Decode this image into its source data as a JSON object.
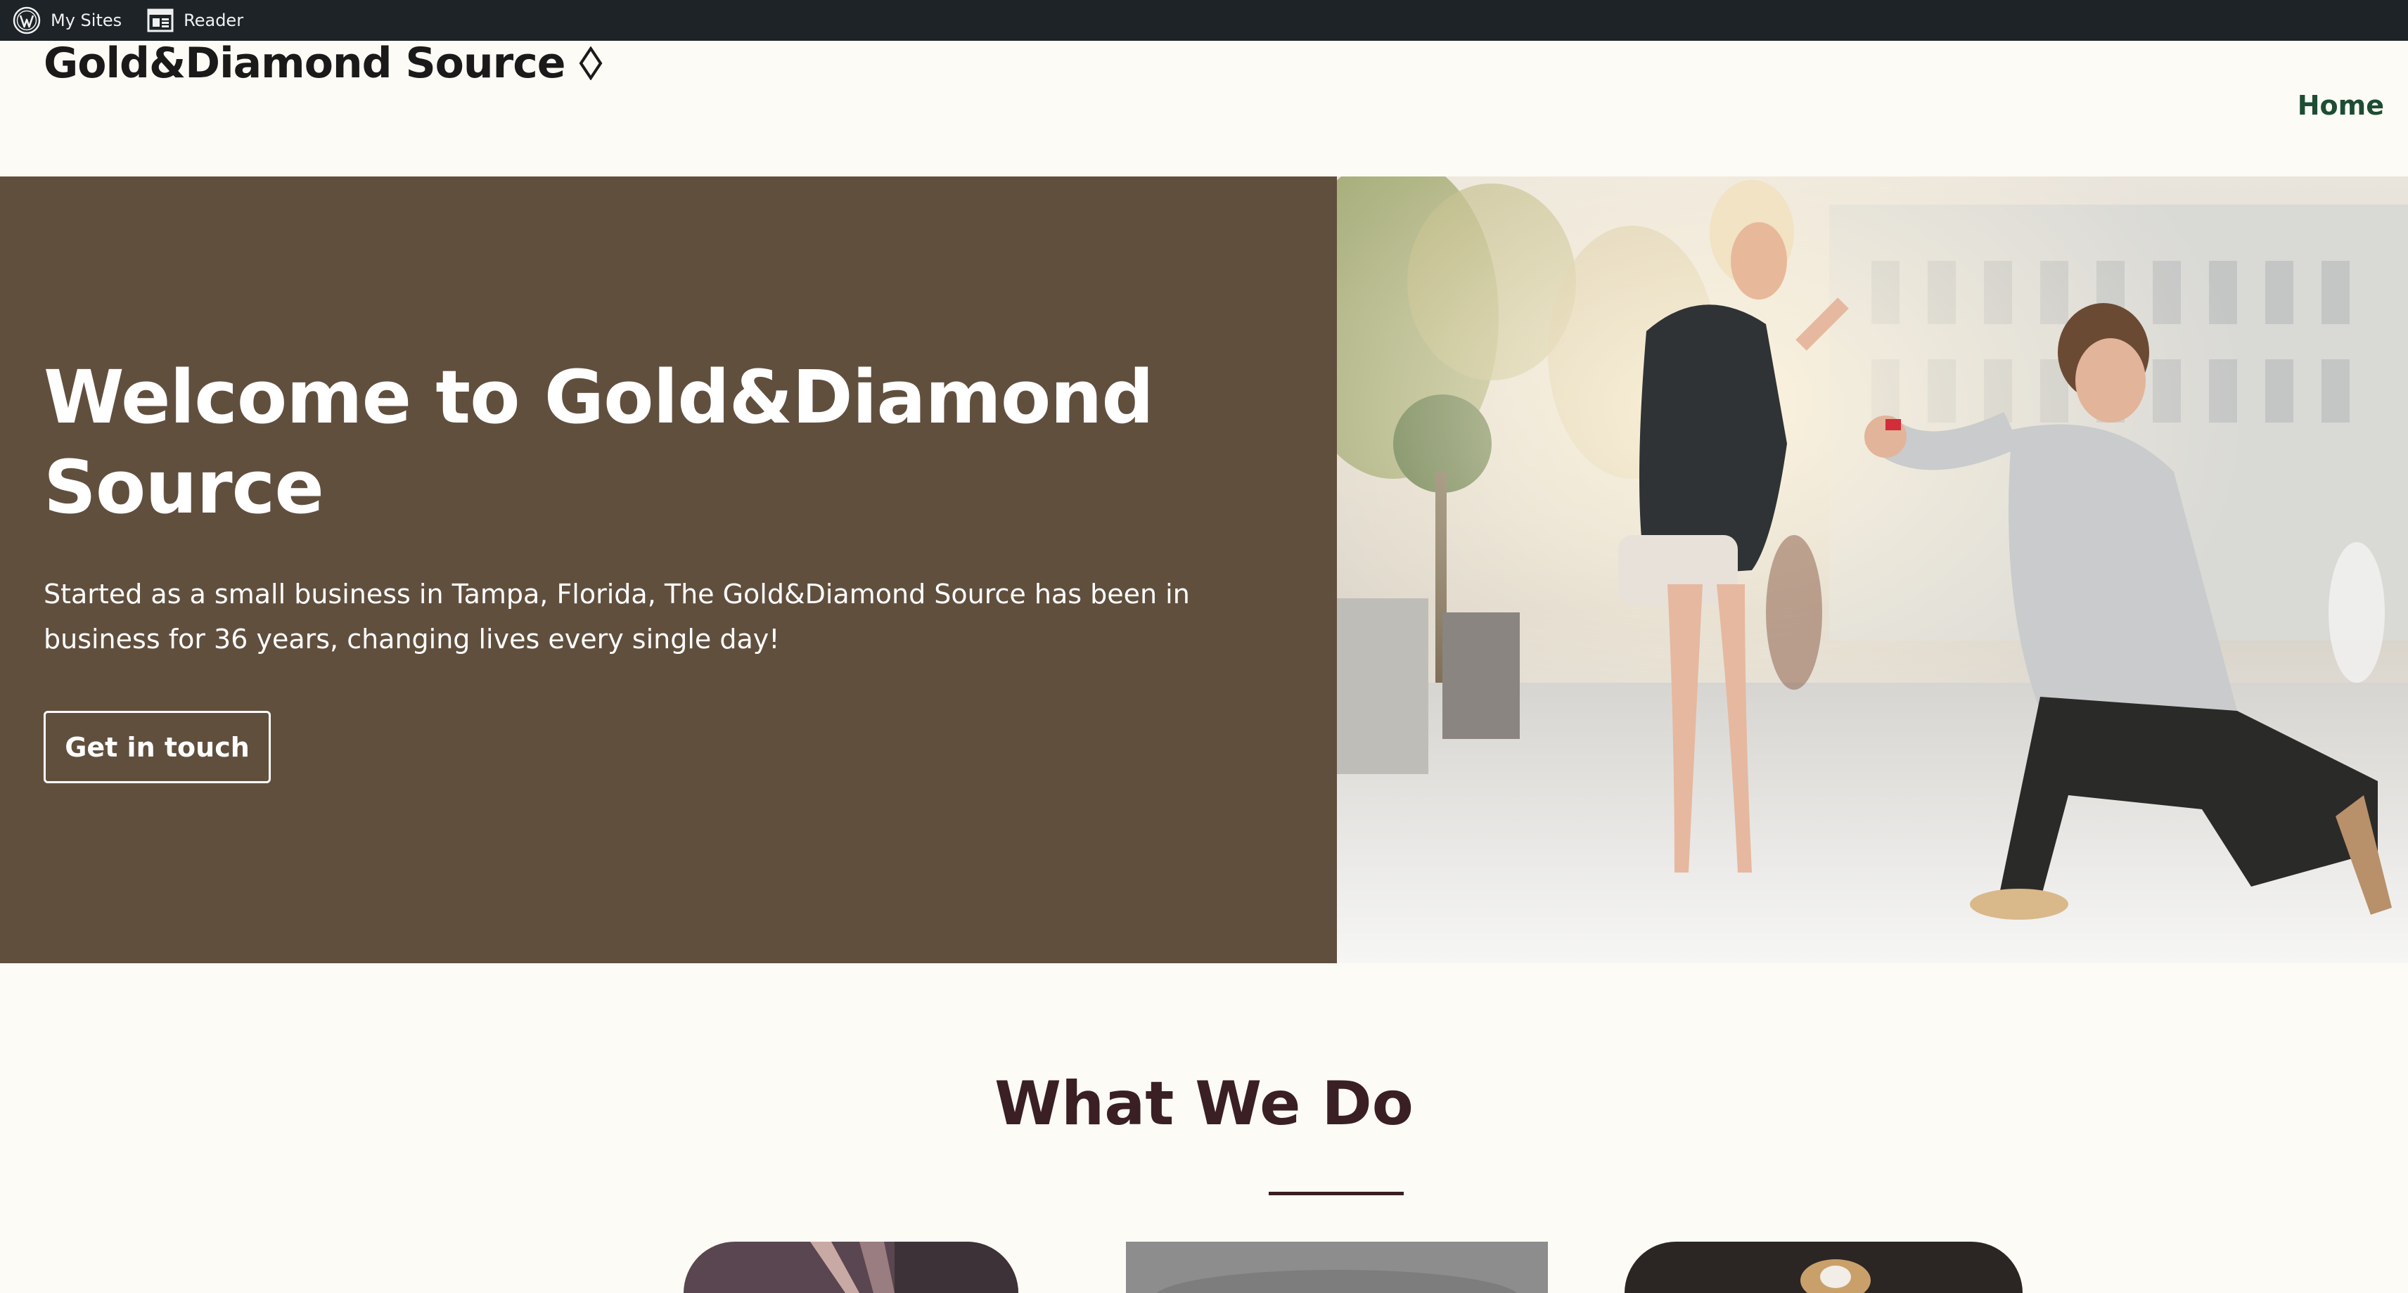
{
  "adminbar": {
    "my_sites": "My Sites",
    "reader": "Reader",
    "wp_icon": "wordpress-logo-icon",
    "reader_icon": "reader-icon"
  },
  "header": {
    "site_title": "Gold&Diamond Source",
    "title_icon": "diamond-icon",
    "nav": [
      "Home"
    ]
  },
  "hero": {
    "title": "Welcome to Gold&Diamond Source",
    "text": "Started as a small business in Tampa, Florida, The Gold&Diamond Source has been in business for 36 years, changing lives every single day!",
    "button": "Get in touch",
    "background_color": "#614f3e"
  },
  "section": {
    "title": "What We Do"
  },
  "colors": {
    "admin_bar": "#1d2327",
    "page_bg": "#fdfbf5",
    "nav_green": "#1e4d33",
    "heading_dark": "#3a1f24"
  }
}
